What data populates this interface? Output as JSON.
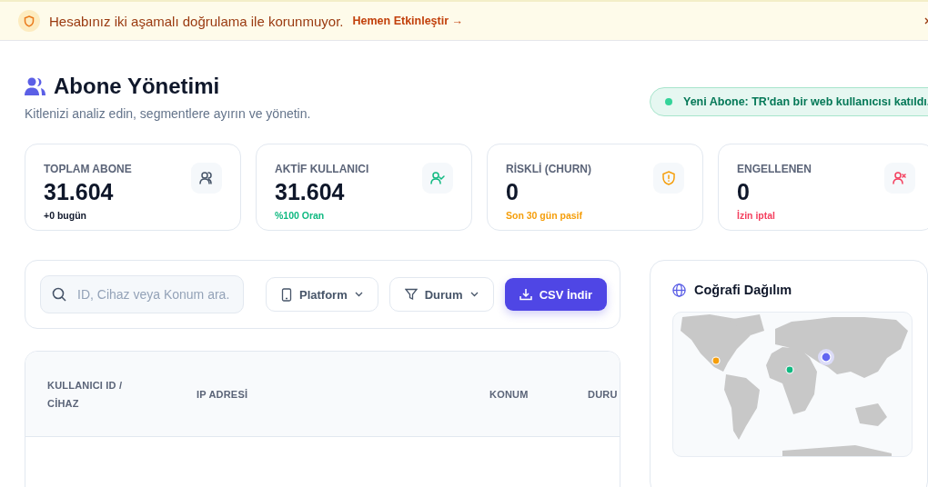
{
  "banner": {
    "message": "Hesabınız iki aşamalı doğrulama ile korunmuyor.",
    "link": "Hemen Etkinleştir →"
  },
  "header": {
    "title": "Abone Yönetimi",
    "subtitle": "Kitlenizi analiz edin, segmentlere ayırın ve yönetin."
  },
  "toast": {
    "text": "Yeni Abone: TR'dan bir web kullanıcısı katıldı."
  },
  "stats": [
    {
      "label": "TOPLAM ABONE",
      "value": "31.604",
      "note": "+0 bugün",
      "kind": "total"
    },
    {
      "label": "AKTİF KULLANICI",
      "value": "31.604",
      "note": "%100 Oran",
      "kind": "active"
    },
    {
      "label": "RİSKLİ (CHURN)",
      "value": "0",
      "note": "Son 30 gün pasif",
      "kind": "risk"
    },
    {
      "label": "ENGELLENEN",
      "value": "0",
      "note": "İzin iptal",
      "kind": "blocked"
    }
  ],
  "filters": {
    "search_placeholder": "ID, Cihaz veya Konum ara.",
    "platform": "Platform",
    "status": "Durum",
    "export": "CSV İndir"
  },
  "table": {
    "columns": [
      "KULLANICI ID / CİHAZ",
      "IP ADRESİ",
      "KONUM",
      "DURU"
    ]
  },
  "geo": {
    "title": "Coğrafi Dağılım",
    "markers": [
      {
        "color": "#f59e0b",
        "highlighted": false
      },
      {
        "color": "#10b981",
        "highlighted": false
      },
      {
        "color": "#6366f1",
        "highlighted": true
      }
    ]
  }
}
